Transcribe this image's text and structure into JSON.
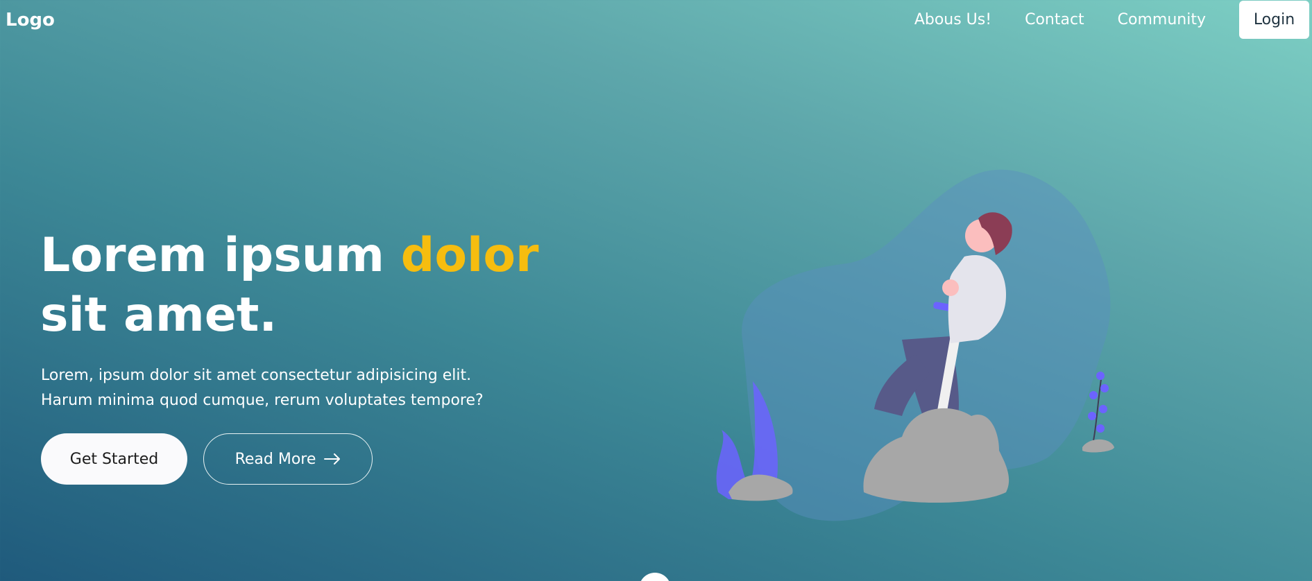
{
  "nav": {
    "logo": "Logo",
    "links": [
      "Abous Us!",
      "Contact",
      "Community"
    ],
    "login_label": "Login"
  },
  "hero": {
    "title_part1": "Lorem ipsum ",
    "title_highlight": "dolor",
    "title_part2": " sit amet.",
    "subtitle": "Lorem, ipsum dolor sit amet consectetur adipisicing elit. Harum minima quod cumque, rerum voluptates tempore?",
    "primary_button": "Get Started",
    "secondary_button": "Read More"
  },
  "colors": {
    "accent": "#f6bd0f",
    "illustration_purple": "#6c63ff"
  },
  "icons": [
    "arrow-right-icon"
  ]
}
